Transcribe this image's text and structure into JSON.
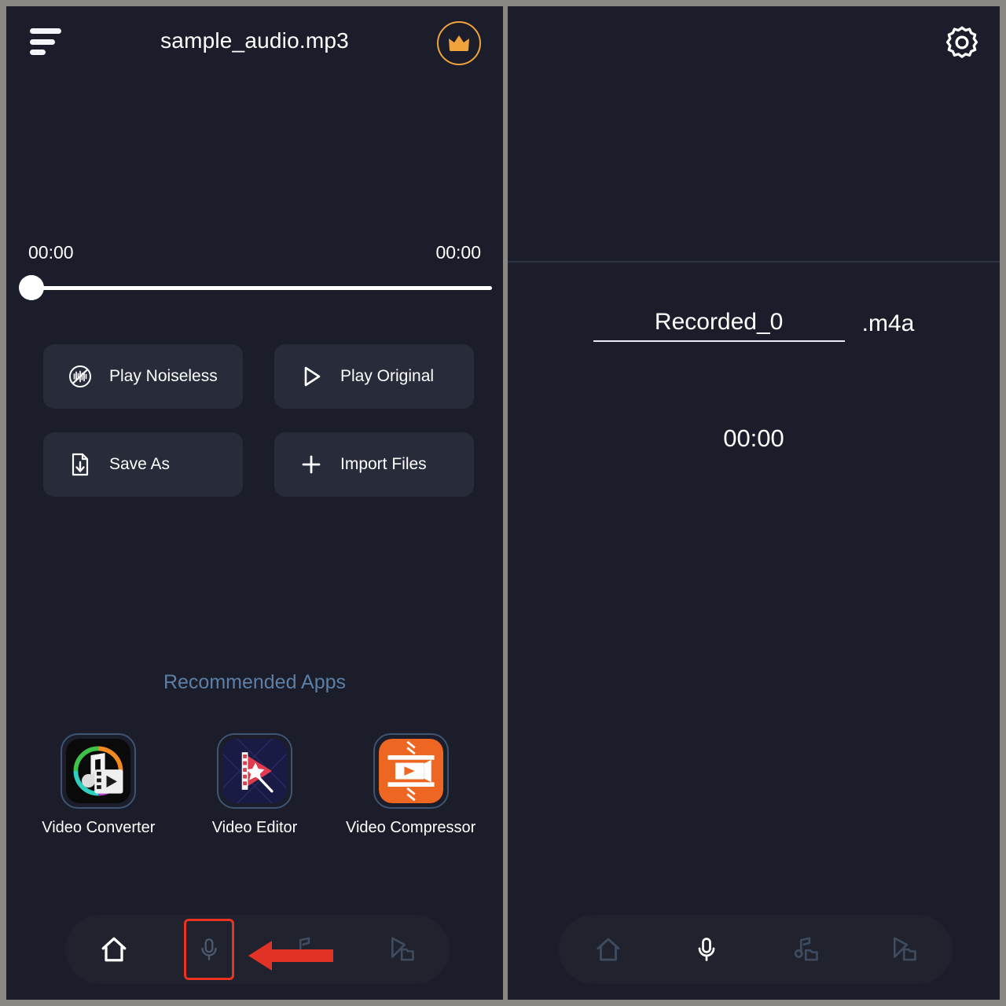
{
  "left_panel": {
    "header": {
      "menu_icon": "sort-lines-icon",
      "title": "sample_audio.mp3",
      "premium_icon": "crown-icon"
    },
    "player": {
      "current_time": "00:00",
      "total_time": "00:00",
      "progress_percent": 0
    },
    "actions": [
      {
        "label": "Play Noiseless",
        "icon": "noise-cancel-icon"
      },
      {
        "label": "Play Original",
        "icon": "play-triangle-icon"
      },
      {
        "label": "Save As",
        "icon": "file-download-icon"
      },
      {
        "label": "Import Files",
        "icon": "plus-icon"
      }
    ],
    "recommended": {
      "title": "Recommended Apps",
      "apps": [
        {
          "label": "Video Converter",
          "icon": "video-converter-app-icon"
        },
        {
          "label": "Video Editor",
          "icon": "video-editor-app-icon"
        },
        {
          "label": "Video Compressor",
          "icon": "video-compressor-app-icon"
        }
      ]
    },
    "nav": [
      {
        "icon": "home-icon",
        "active": true,
        "highlighted": false
      },
      {
        "icon": "microphone-icon",
        "active": false,
        "highlighted": true
      },
      {
        "icon": "music-folder-icon",
        "active": false,
        "highlighted": false
      },
      {
        "icon": "video-folder-icon",
        "active": false,
        "highlighted": false
      }
    ],
    "annotation": {
      "type": "left-arrow",
      "color": "#ea3323",
      "points_to": "microphone-nav-button"
    }
  },
  "right_panel": {
    "header": {
      "settings_icon": "gear-icon"
    },
    "filename": {
      "value": "Recorded_0",
      "extension": ".m4a"
    },
    "timer": "00:00",
    "record_button": {
      "icon": "microphone-icon",
      "highlighted": true
    },
    "nav": [
      {
        "icon": "home-icon",
        "active": false
      },
      {
        "icon": "microphone-icon",
        "active": true
      },
      {
        "icon": "music-folder-icon",
        "active": false
      },
      {
        "icon": "video-folder-icon",
        "active": false
      }
    ]
  },
  "colors": {
    "background": "#1b1d2a",
    "surface": "#272b3a",
    "accent_orange": "#f0a33c",
    "accent_red": "#ea3323",
    "record_red": "#d8411e",
    "muted_blue": "#5d7fa6",
    "text": "#ffffff"
  }
}
